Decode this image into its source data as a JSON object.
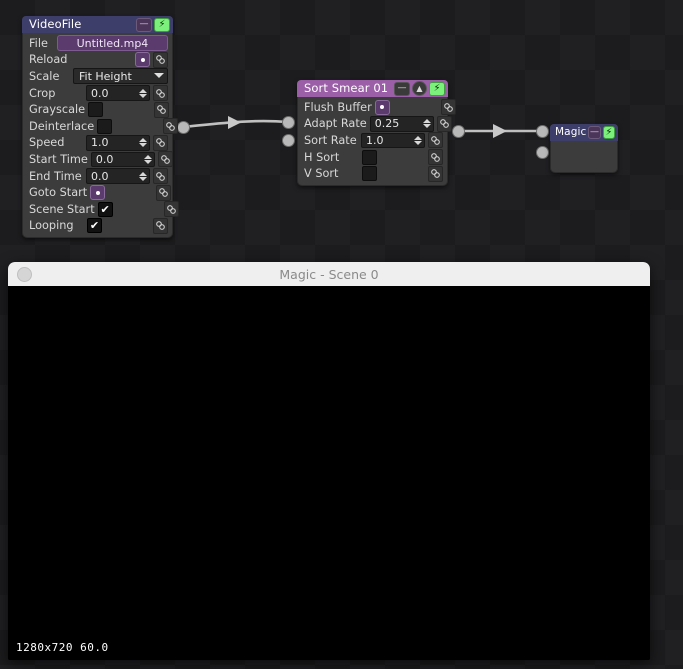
{
  "app": {
    "background_dark": "#1c1c1e",
    "background_light": "#202023"
  },
  "nodes": [
    {
      "id": "videofile",
      "title": "VideoFile",
      "title_color": "#3e3e6b",
      "buttons": [
        "minimize",
        "bolt"
      ],
      "rows": [
        {
          "label": "File",
          "type": "path",
          "value": "Untitled.mp4",
          "link": false
        },
        {
          "label": "Reload",
          "type": "dotbutton",
          "value": "",
          "link": true
        },
        {
          "label": "Scale",
          "type": "select",
          "value": "Fit Height",
          "link": false
        },
        {
          "label": "Crop",
          "type": "number",
          "value": "0.0",
          "link": true
        },
        {
          "label": "Grayscale",
          "type": "box",
          "value": "",
          "link": true
        },
        {
          "label": "Deinterlace",
          "type": "box",
          "value": "",
          "link": true
        },
        {
          "label": "Speed",
          "type": "number",
          "value": "1.0",
          "link": true
        },
        {
          "label": "Start Time",
          "type": "number",
          "value": "0.0",
          "link": true
        },
        {
          "label": "End Time",
          "type": "number",
          "value": "0.0",
          "link": true
        },
        {
          "label": "Goto Start",
          "type": "dotbutton",
          "value": "",
          "link": true
        },
        {
          "label": "Scene Start",
          "type": "check",
          "value": "✔",
          "link": true
        },
        {
          "label": "Looping",
          "type": "check",
          "value": "✔",
          "link": true
        }
      ]
    },
    {
      "id": "sortsmear",
      "title": "Sort Smear 01",
      "title_color": "#9b5fa8",
      "buttons": [
        "minimize",
        "circle",
        "bolt"
      ],
      "rows": [
        {
          "label": "Flush Buffer",
          "type": "dotbutton",
          "value": "",
          "link": true
        },
        {
          "label": "Adapt Rate",
          "type": "number",
          "value": "0.25",
          "link": true
        },
        {
          "label": "Sort Rate",
          "type": "number",
          "value": "1.0",
          "link": true
        },
        {
          "label": "H Sort",
          "type": "box",
          "value": "",
          "link": true
        },
        {
          "label": "V Sort",
          "type": "box",
          "value": "",
          "link": true
        }
      ]
    },
    {
      "id": "magic",
      "title": "Magic",
      "title_color": "#3e3e6b",
      "buttons": [
        "minimize",
        "bolt"
      ],
      "rows": []
    }
  ],
  "icons": {
    "minimize": "—",
    "circle": "▲",
    "bolt": "⚡",
    "link": "link-chain-icon",
    "caret": "chevron-down-icon",
    "check": "✔"
  },
  "preview": {
    "window_title": "Magic - Scene 0",
    "resolution": "1280x720  60.0"
  }
}
